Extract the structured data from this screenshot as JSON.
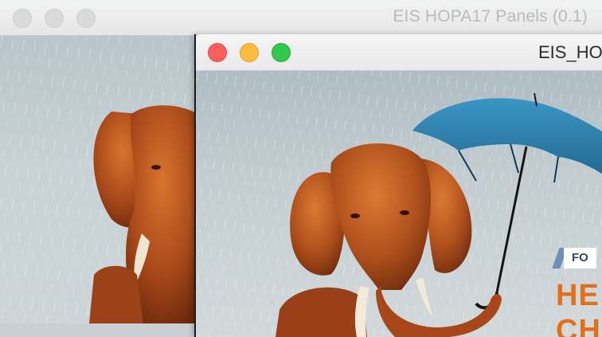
{
  "back_window": {
    "title": "EIS HOPA17 Panels (0.1)",
    "traffic_lights": [
      "close-button",
      "minimize-button",
      "zoom-button"
    ]
  },
  "front_window": {
    "title": "EIS_HO",
    "traffic_lights": [
      "close-button",
      "minimize-button",
      "zoom-button"
    ]
  },
  "ad": {
    "tag_text": "FO",
    "headline_line1": "HE",
    "headline_line2": "CH",
    "colors": {
      "headline": "#e2701a",
      "tag_stripe": "#6e8fb7",
      "umbrella": "#2b7fae",
      "elephant": "#b8561d"
    }
  }
}
